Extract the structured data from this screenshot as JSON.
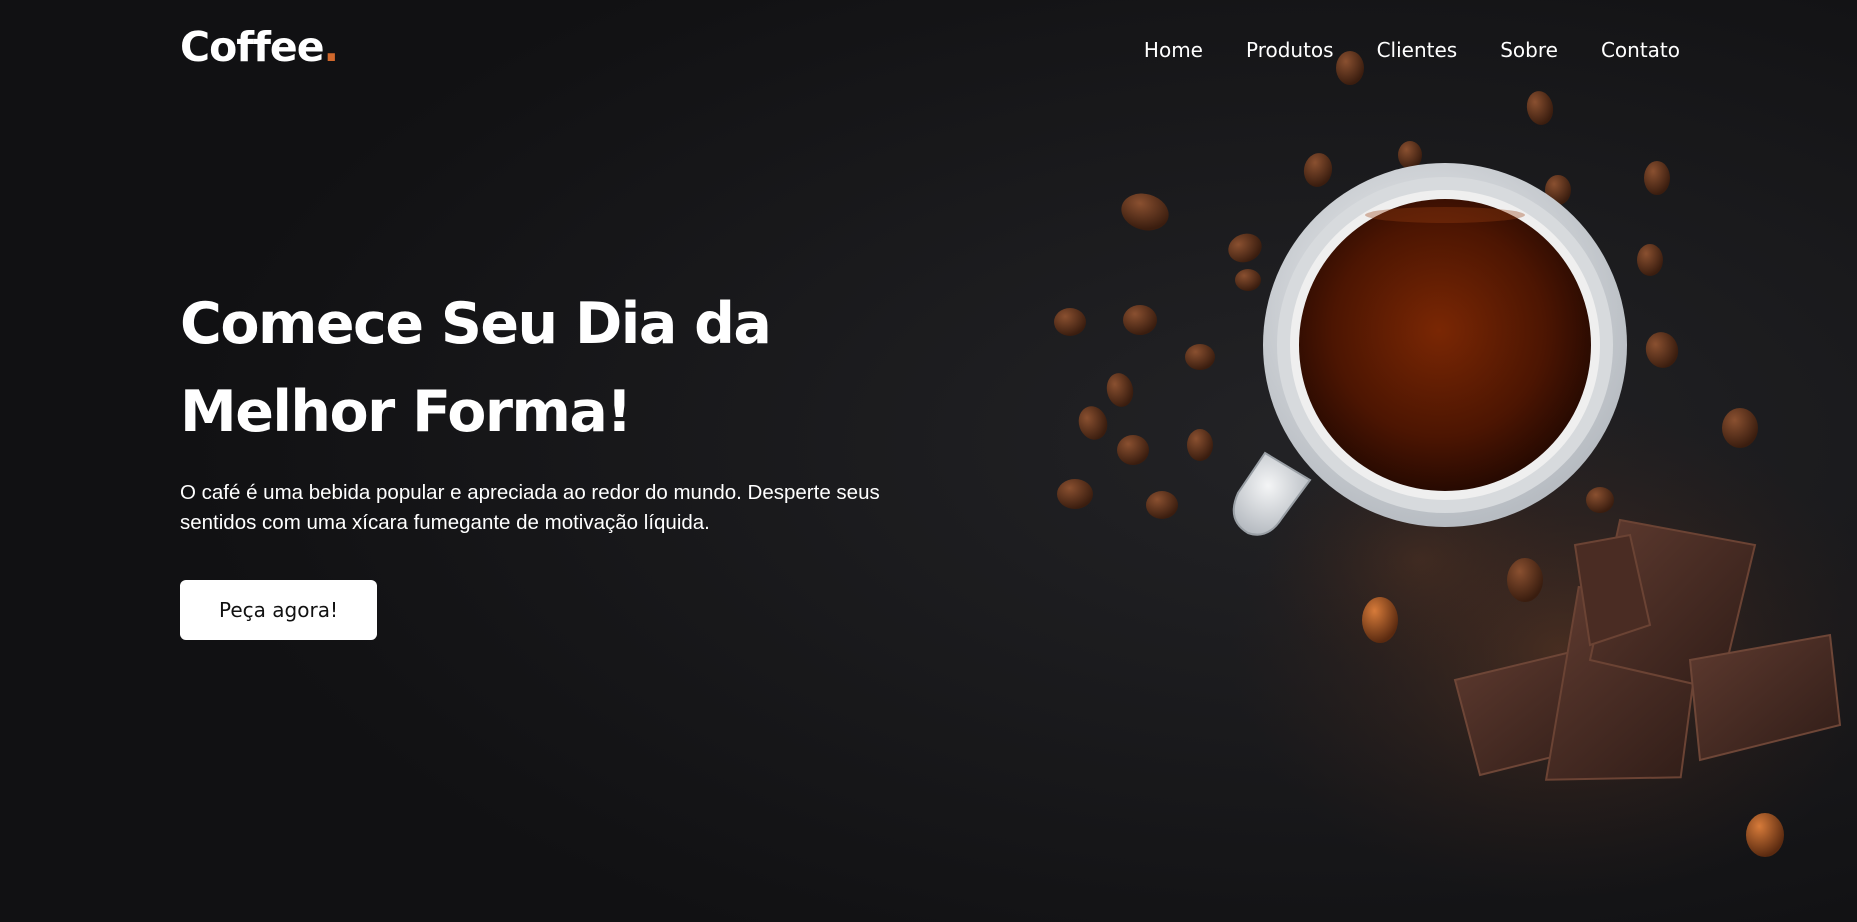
{
  "page": {
    "colors": {
      "background": "#141416",
      "text": "#ffffff",
      "accent": "#d1682c",
      "button_bg": "#ffffff",
      "button_text": "#111111"
    }
  },
  "header": {
    "logo_text": "Coffee",
    "logo_dot": ".",
    "nav": [
      {
        "label": "Home"
      },
      {
        "label": "Produtos"
      },
      {
        "label": "Clientes"
      },
      {
        "label": "Sobre"
      },
      {
        "label": "Contato"
      }
    ]
  },
  "hero": {
    "title_line1": "Comece Seu Dia da",
    "title_line2": "Melhor Forma!",
    "description": "O café é uma bebida popular e apreciada ao redor do mundo. Desperte seus sentidos com uma xícara fumegante de motivação líquida.",
    "cta_label": "Peça agora!",
    "image": {
      "subject": "coffee cup with coffee beans, hazelnuts and chocolate pieces on dark background"
    }
  }
}
